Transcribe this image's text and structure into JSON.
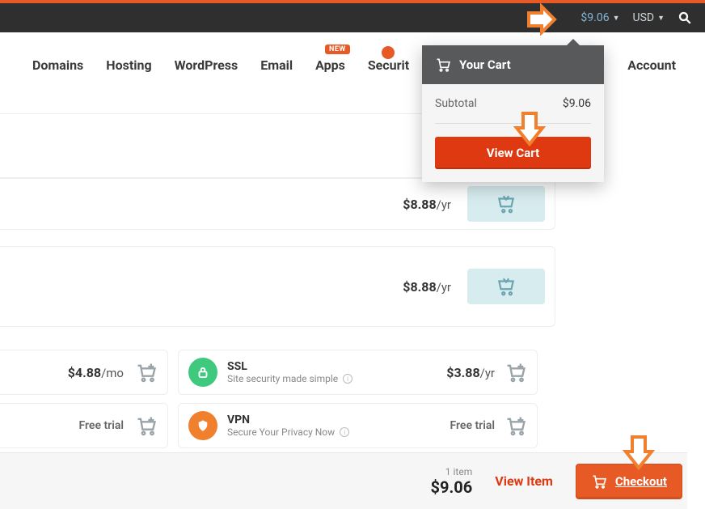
{
  "topbar": {
    "cart_total": "$9.06",
    "currency": "USD"
  },
  "nav": {
    "items": [
      "Domains",
      "Hosting",
      "WordPress",
      "Email",
      "Apps",
      "Securit",
      "",
      "Account"
    ],
    "new_badge": "NEW"
  },
  "cart_dropdown": {
    "title": "Your Cart",
    "subtotal_label": "Subtotal",
    "subtotal_value": "$9.06",
    "view_cart": "View Cart"
  },
  "results": [
    {
      "price": "$8.88",
      "per": "/yr"
    },
    {
      "price": "$8.88",
      "per": "/yr"
    }
  ],
  "addons_left": [
    {
      "price": "$4.88",
      "per": "/mo"
    },
    {
      "label": "Free trial"
    }
  ],
  "addons_right": [
    {
      "title": "SSL",
      "subtitle": "Site security made simple",
      "price": "$3.88",
      "per": "/yr"
    },
    {
      "title": "VPN",
      "subtitle": "Secure Your Privacy Now",
      "label": "Free trial"
    }
  ],
  "footer": {
    "count": "1 item",
    "total": "$9.06",
    "view_item": "View Item",
    "checkout": "Checkout"
  }
}
